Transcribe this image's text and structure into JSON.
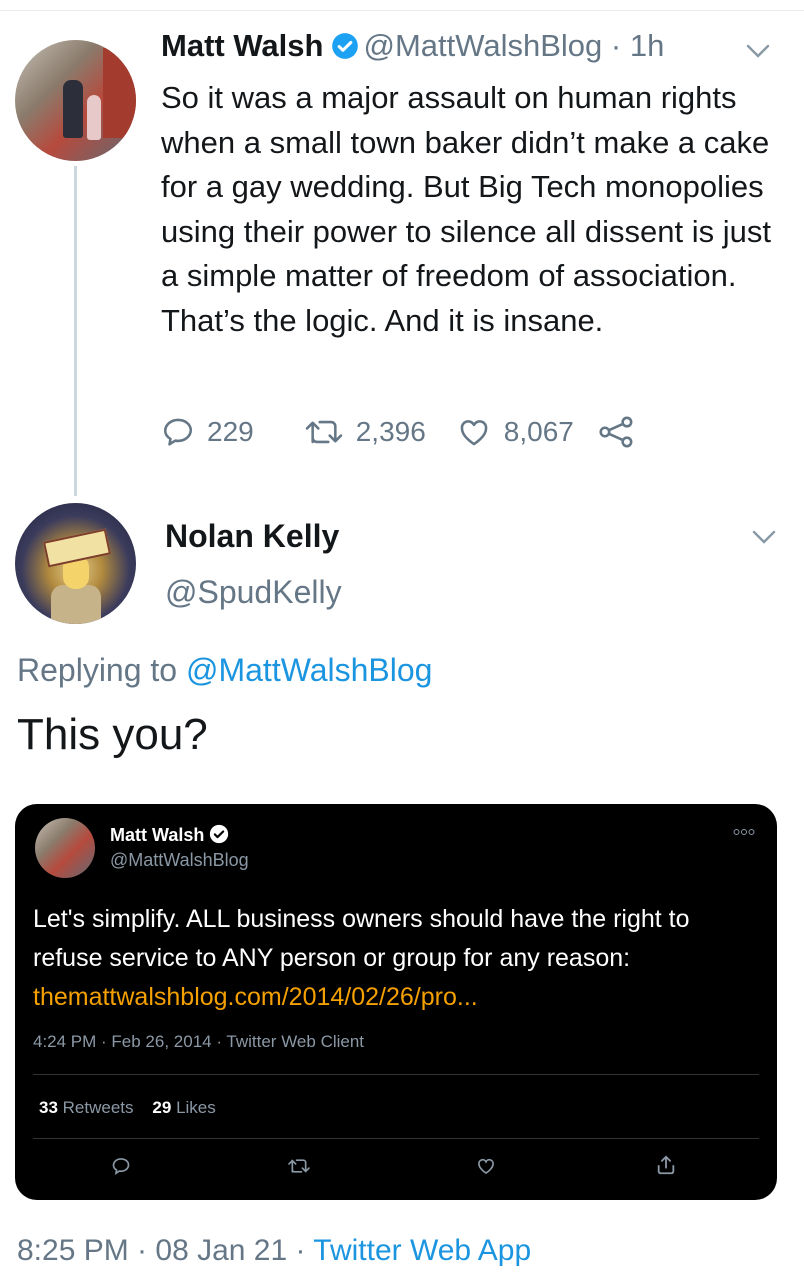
{
  "main_tweet": {
    "name": "Matt Walsh",
    "handle": "@MattWalshBlog",
    "time_sep": " · ",
    "time": "1h",
    "text": "So it was a major assault on human rights when a small town baker didn’t make a cake for a gay wedding. But Big Tech monopolies using their power to silence all dissent is just a simple matter of freedom of association. That’s the logic. And it is insane.",
    "replies": "229",
    "retweets": "2,396",
    "likes": "8,067"
  },
  "reply_tweet": {
    "name": "Nolan Kelly",
    "handle": "@SpudKelly",
    "replying_prefix": "Replying to ",
    "replying_to": "@MattWalshBlog",
    "text": "This you?",
    "footer_time": "8:25 PM · 08 Jan 21 · ",
    "footer_source": "Twitter Web App"
  },
  "embedded": {
    "name": "Matt Walsh",
    "handle": "@MattWalshBlog",
    "text": "Let's simplify. ALL business owners should have the right to refuse service to ANY person or group for any reason: ",
    "link": "themattwalshblog.com/2014/02/26/pro...",
    "meta": "4:24 PM · Feb 26, 2014 · Twitter Web Client",
    "retweets_count": "33",
    "retweets_label": " Retweets",
    "likes_count": "29",
    "likes_label": " Likes"
  },
  "colors": {
    "link": "#1b95e0",
    "secondary": "#657786",
    "embedded_link": "#f4a000",
    "embedded_bg": "#000000"
  }
}
